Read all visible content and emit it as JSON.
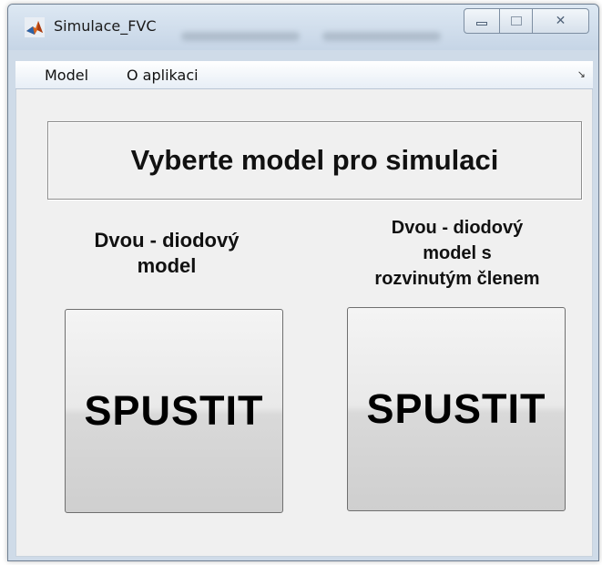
{
  "window": {
    "title": "Simulace_FVC",
    "controls": {
      "minimize_icon": "minimize-icon",
      "maximize_icon": "maximize-icon",
      "close_glyph": "✕"
    },
    "colors": {
      "frame": "#cfdbe8",
      "client_bg": "#f0f0f0"
    }
  },
  "menubar": {
    "items": [
      {
        "label": "Model"
      },
      {
        "label": "O aplikaci"
      }
    ],
    "overflow_glyph": "↘"
  },
  "main": {
    "header": "Vyberte model pro simulaci",
    "left": {
      "title_line1": "Dvou - diodový",
      "title_line2": "model",
      "button_label": "SPUSTIT"
    },
    "right": {
      "title_line1": "Dvou - diodový",
      "title_line2": "model s",
      "title_line3": "rozvinutým členem",
      "button_label": "SPUSTIT"
    }
  }
}
